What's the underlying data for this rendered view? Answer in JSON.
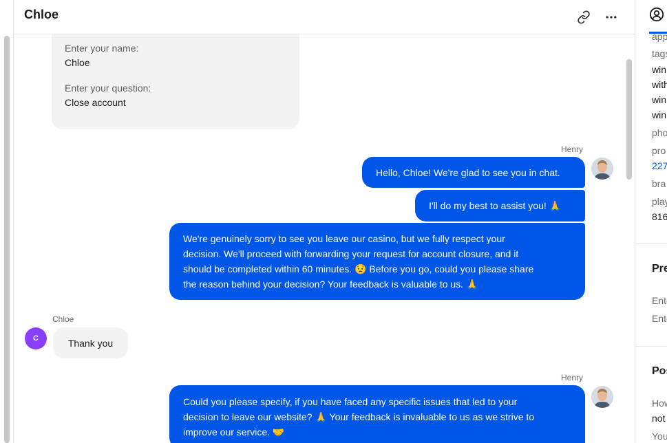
{
  "header": {
    "title": "Chloe",
    "link_icon": "link-icon",
    "more_icon": "more-horizontal-icon"
  },
  "form": {
    "name_label": "Enter your name:",
    "name_value": "Chloe",
    "question_label": "Enter your question:",
    "question_value": "Close account"
  },
  "messages": [
    {
      "sender": "Henry",
      "direction": "out",
      "text": "Hello, Chloe! We're glad to see you in chat."
    },
    {
      "sender": "Henry",
      "direction": "out",
      "text": "I'll do my best to assist you! 🙏"
    },
    {
      "sender": "Henry",
      "direction": "out",
      "lines": [
        "We're genuinely sorry to see you leave our casino, but we fully respect your",
        "decision. We'll proceed with forwarding your request for account closure, and it",
        "should be completed within 60 minutes. 😟 Before you go, could you please share",
        "the reason behind your decision? Your feedback is valuable to us. 🙏"
      ]
    },
    {
      "sender": "Chloe",
      "direction": "in",
      "avatar_initial": "C",
      "text": "Thank you"
    },
    {
      "sender": "Henry",
      "direction": "out",
      "lines": [
        "Could you please specify, if you have faced any specific issues that led to your",
        "decision to leave our website? 🙏 Your feedback is invaluable to us as we strive to",
        "improve our service. 🤝"
      ]
    }
  ],
  "right_panel": {
    "tab_icon": "user-circle-icon",
    "fields": [
      "app",
      "tags",
      "win",
      "with",
      "win",
      "win",
      "pho",
      "pro",
      "227",
      "bra",
      "play",
      "816"
    ],
    "section_pre": "Pre",
    "pre_items": [
      "Ente",
      "Ente"
    ],
    "section_pos": "Pos",
    "pos_items": [
      "How",
      "not",
      "You"
    ]
  },
  "colors": {
    "accent": "#0057e7",
    "user_avatar": "#8a3ffc",
    "incoming_bubble": "#f3f3f4"
  }
}
